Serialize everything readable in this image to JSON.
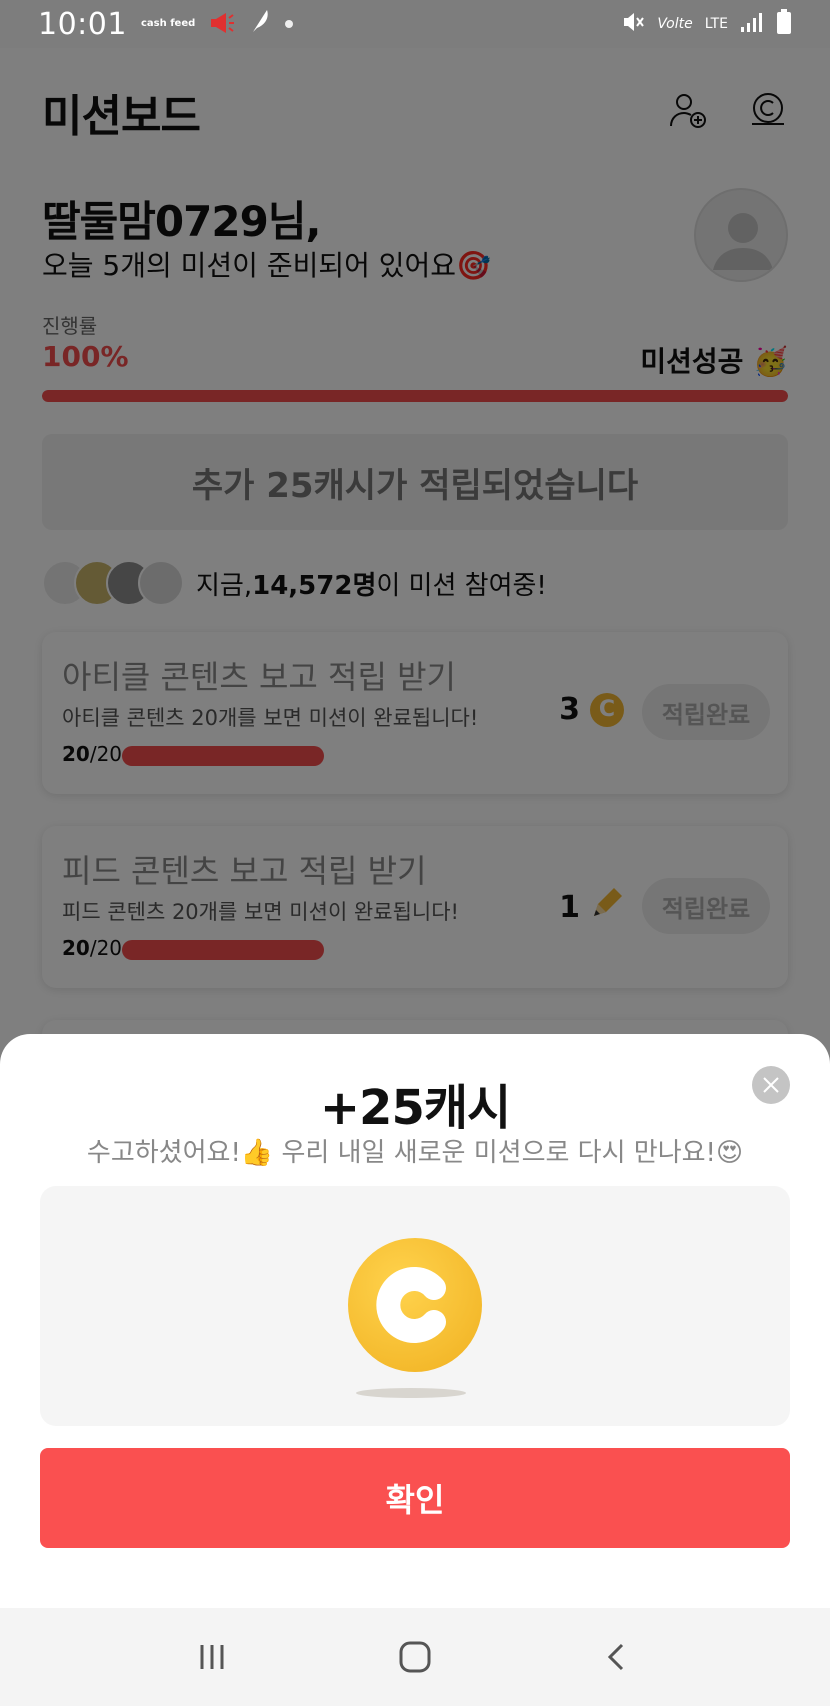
{
  "status_bar": {
    "time": "10:01",
    "brand": "cash feed",
    "network": "LTE",
    "volte": "Volte"
  },
  "header": {
    "title": "미션보드",
    "icons": [
      "add-user-icon",
      "coin-icon"
    ]
  },
  "greeting": {
    "name": "딸둘맘0729님,",
    "subtitle": "오늘 5개의 미션이 준비되어 있어요🎯"
  },
  "progress": {
    "label": "진행률",
    "value": "100%",
    "fraction": 1.0,
    "status": "미션성공 🥳"
  },
  "bonus_banner": "추가 25캐시가 적립되었습니다",
  "participants": {
    "prefix": "지금, ",
    "count": "14,572명",
    "suffix": "이 미션 참여중!"
  },
  "missions": [
    {
      "title": "아티클 콘텐츠 보고 적립 받기",
      "desc": "아티클 콘텐츠 20개를 보면 미션이 완료됩니다!",
      "done": "20",
      "total": "/20",
      "reward": "3",
      "reward_icon": "coin-icon",
      "button": "적립완료"
    },
    {
      "title": "피드 콘텐츠 보고 적립 받기",
      "desc": "피드 콘텐츠 20개를 보면 미션이 완료됩니다!",
      "done": "20",
      "total": "/20",
      "reward": "1",
      "reward_icon": "pencil-icon",
      "button": "적립완료"
    }
  ],
  "modal": {
    "title": "+25캐시",
    "message": "수고하셨어요!👍 우리 내일 새로운 미션으로 다시 만나요!😍",
    "confirm": "확인"
  },
  "colors": {
    "accent": "#fa5050",
    "coin": "#f2b733"
  }
}
